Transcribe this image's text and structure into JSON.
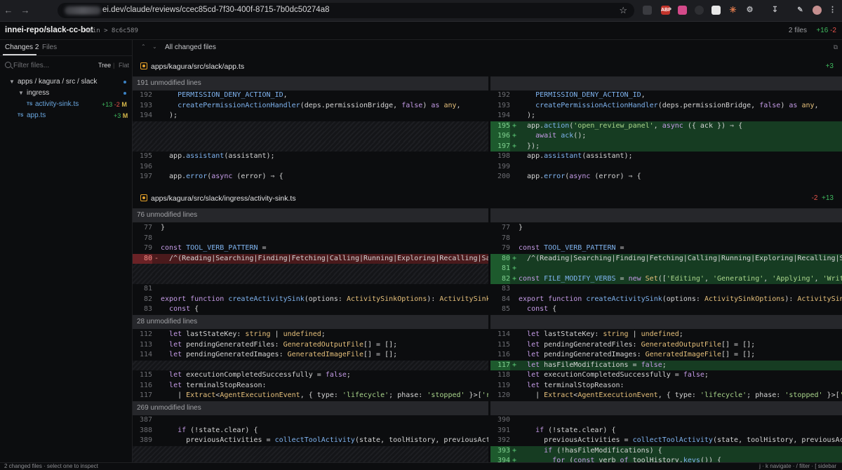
{
  "browser": {
    "url_visible": "ei.dev/claude/reviews/ccec85cd-7f30-400f-8715-7b0dc50274a8",
    "extensions": [
      {
        "name": "media-icon",
        "label": "",
        "color": "#3a3b40"
      },
      {
        "name": "abp-icon",
        "label": "ABP",
        "color": "#c2342b"
      },
      {
        "name": "puzzle-pink-icon",
        "label": "",
        "color": "#d44a8a"
      },
      {
        "name": "compass-icon",
        "label": "",
        "color": "#2e2f33"
      },
      {
        "name": "notion-icon",
        "label": "",
        "color": "#e8e8e8"
      },
      {
        "name": "claude-icon",
        "label": "",
        "color": "#d9774b"
      },
      {
        "name": "extensions-icon",
        "label": "",
        "color": "#2e2f33"
      },
      {
        "name": "download-icon",
        "label": "",
        "color": "#2e2f33"
      },
      {
        "name": "edit-icon",
        "label": "",
        "color": "#2e2f33"
      },
      {
        "name": "profile-avatar",
        "label": "",
        "color": "#c58f8f"
      }
    ]
  },
  "header": {
    "repo": "innei-repo/slack-cc-bot",
    "branch": "main > 8c6c589",
    "files_count": "2 files",
    "additions": "+16",
    "deletions": "-2"
  },
  "sidebar": {
    "tab_changes": "Changes",
    "tab_changes_count": "2",
    "tab_files": "Files",
    "filter_placeholder": "Filter files...",
    "tree_label": "Tree",
    "flat_label": "Flat",
    "tree": {
      "dir_path": "apps / kagura / src / slack",
      "subdir": "ingress",
      "file1": {
        "name": "activity-sink.ts",
        "add": "+13",
        "del": "-2",
        "status": "M",
        "badge": "TS"
      },
      "file2": {
        "name": "app.ts",
        "add": "+3",
        "status": "M",
        "badge": "TS"
      }
    }
  },
  "main": {
    "all_changed": "All changed files",
    "file1": {
      "path": "apps/kagura/src/slack/app.ts",
      "add": "+3",
      "unmod1": "191 unmodified lines"
    },
    "file2": {
      "path": "apps/kagura/src/slack/ingress/activity-sink.ts",
      "del": "-2",
      "add": "+13",
      "unmod1": "76 unmodified lines",
      "unmod2": "28 unmodified lines",
      "unmod3": "269 unmodified lines"
    }
  },
  "status_bar": {
    "left": "2 changed files · select one to inspect",
    "right": "j · k navigate · / filter · [ sidebar"
  }
}
